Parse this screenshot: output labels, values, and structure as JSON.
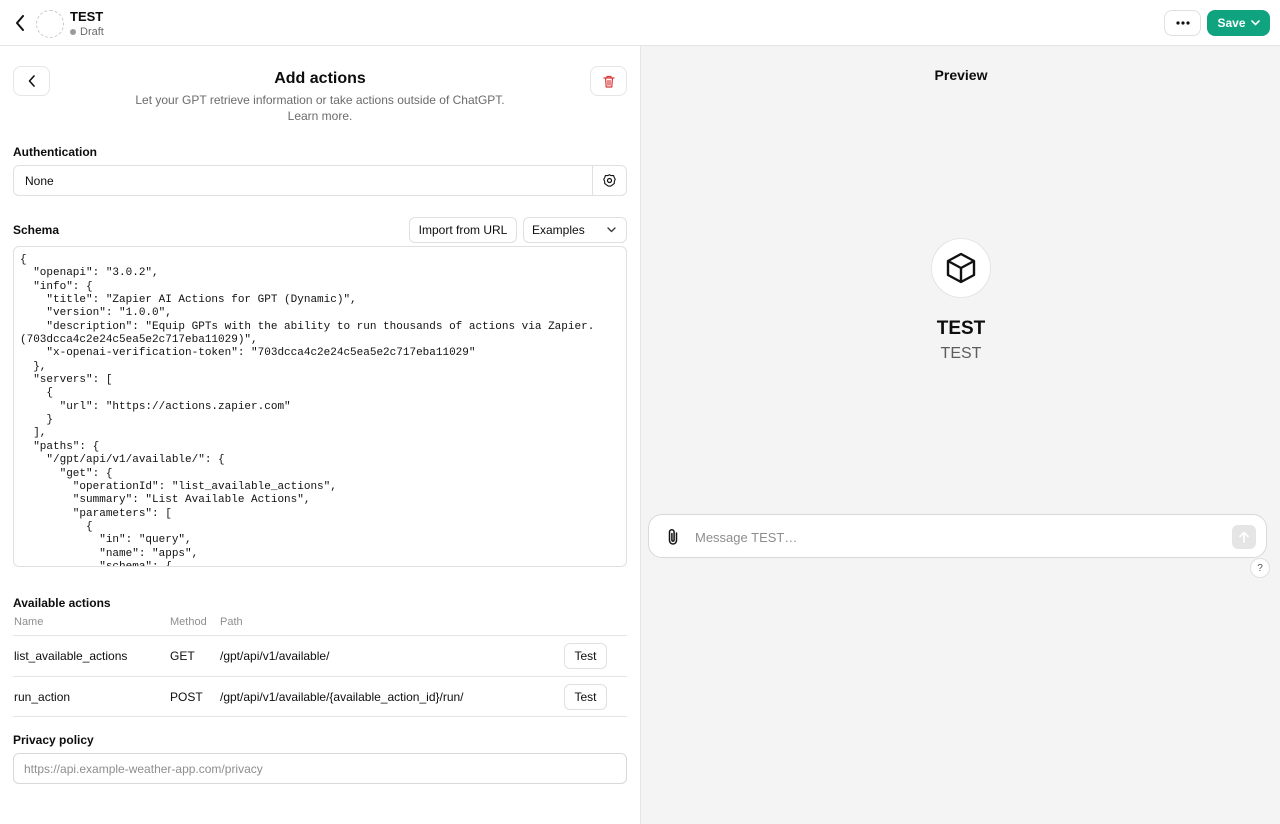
{
  "header": {
    "gpt_name": "TEST",
    "status": "Draft",
    "save_label": "Save"
  },
  "editor": {
    "title": "Add actions",
    "subtitle": "Let your GPT retrieve information or take actions outside of ChatGPT.",
    "learn_more": "Learn more.",
    "authentication": {
      "label": "Authentication",
      "value": "None"
    },
    "schema": {
      "label": "Schema",
      "import_label": "Import from URL",
      "examples_label": "Examples",
      "text": "{\n  \"openapi\": \"3.0.2\",\n  \"info\": {\n    \"title\": \"Zapier AI Actions for GPT (Dynamic)\",\n    \"version\": \"1.0.0\",\n    \"description\": \"Equip GPTs with the ability to run thousands of actions via Zapier.\n(703dcca4c2e24c5ea5e2c717eba11029)\",\n    \"x-openai-verification-token\": \"703dcca4c2e24c5ea5e2c717eba11029\"\n  },\n  \"servers\": [\n    {\n      \"url\": \"https://actions.zapier.com\"\n    }\n  ],\n  \"paths\": {\n    \"/gpt/api/v1/available/\": {\n      \"get\": {\n        \"operationId\": \"list_available_actions\",\n        \"summary\": \"List Available Actions\",\n        \"parameters\": [\n          {\n            \"in\": \"query\",\n            \"name\": \"apps\",\n            \"schema\": {"
    },
    "available_actions": {
      "label": "Available actions",
      "columns": [
        "Name",
        "Method",
        "Path"
      ],
      "test_label": "Test",
      "rows": [
        {
          "name": "list_available_actions",
          "method": "GET",
          "path": "/gpt/api/v1/available/"
        },
        {
          "name": "run_action",
          "method": "POST",
          "path": "/gpt/api/v1/available/{available_action_id}/run/"
        }
      ]
    },
    "privacy": {
      "label": "Privacy policy",
      "placeholder": "https://api.example-weather-app.com/privacy"
    }
  },
  "preview": {
    "title": "Preview",
    "gpt_name": "TEST",
    "gpt_description": "TEST",
    "message_placeholder": "Message TEST…",
    "help_label": "?"
  },
  "colors": {
    "accent": "#10a37f",
    "delete": "#d9393b"
  },
  "icons": [
    "back-icon",
    "more-icon",
    "chevron-down-icon",
    "trash-icon",
    "gear-icon",
    "cube-icon",
    "paperclip-icon",
    "arrow-up-icon"
  ]
}
